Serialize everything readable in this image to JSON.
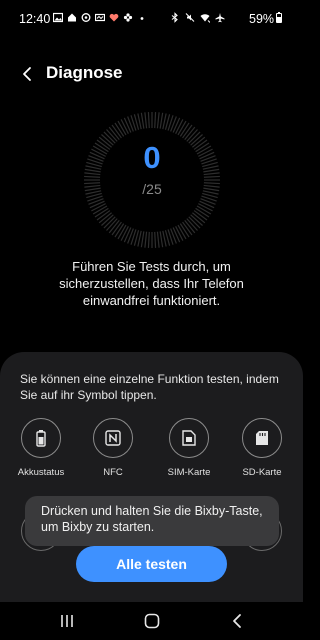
{
  "status_bar": {
    "time": "12:40",
    "battery_percent": "59%",
    "battery_level": 0.59,
    "left_icons": [
      "gallery-icon",
      "home-icon",
      "sync-icon",
      "screen-icon",
      "heart-icon",
      "flower-icon",
      "dot-icon"
    ],
    "right_icons": [
      "bluetooth-icon",
      "mute-icon",
      "wifi-icon",
      "airplane-icon"
    ]
  },
  "header": {
    "title": "Diagnose",
    "back_icon": "chevron-left-icon"
  },
  "score": {
    "value": "0",
    "total": "/25"
  },
  "intro": {
    "text": "Führen Sie Tests durch, um sicherzustellen, dass Ihr Telefon einwandfrei funktioniert."
  },
  "panel": {
    "description": "Sie können eine einzelne Funktion testen, indem Sie auf ihr Symbol tippen.",
    "tests": [
      {
        "label": "Akkustatus",
        "icon": "battery-icon"
      },
      {
        "label": "NFC",
        "icon": "nfc-icon"
      },
      {
        "label": "SIM-Karte",
        "icon": "sim-card-icon"
      },
      {
        "label": "SD-Karte",
        "icon": "sd-card-icon"
      }
    ]
  },
  "toast": {
    "text": "Drücken und halten Sie die Bixby-Taste, um Bixby zu starten."
  },
  "actions": {
    "run_all_label": "Alle testen"
  },
  "nav": {
    "recents_icon": "recents-icon",
    "home_icon": "home-icon",
    "back_icon": "back-icon"
  },
  "colors": {
    "accent": "#3e91ff",
    "background": "#000000",
    "panel": "#1c1c1e",
    "toast": "#3a3a3c"
  }
}
